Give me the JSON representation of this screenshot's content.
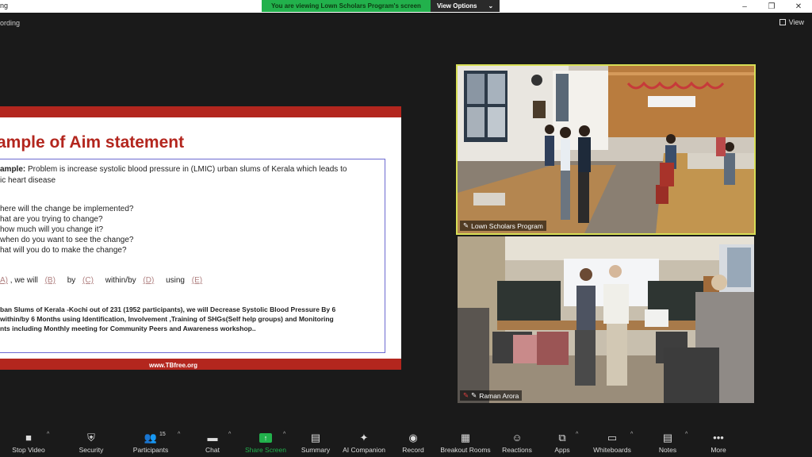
{
  "window": {
    "title": "ng",
    "minimize_glyph": "–",
    "maximize_glyph": "❐",
    "close_glyph": "✕"
  },
  "share_banner": {
    "message": "You are viewing Lown Scholars Program's screen",
    "options_label": "View Options",
    "options_caret": "⌄"
  },
  "recording_label": "ording",
  "view_label": "View",
  "slide": {
    "title": "ample of Aim statement",
    "example_label": "ample:",
    "example_text": " Problem is increase systolic blood pressure in (LMIC) urban slums of Kerala which leads to",
    "example_text2": "ic heart disease",
    "questions": [
      "here will the change be implemented?",
      "hat are you trying to change?",
      "how much will you change it?",
      "when do you want to see the change?",
      "hat will you do to make the change?"
    ],
    "template": {
      "a": "A)",
      "we_will": ", we will",
      "b": "(B)",
      "by": "by",
      "c": "(C)",
      "within": "within/by",
      "d": "(D)",
      "using": "using",
      "e": "(E)"
    },
    "answer_lines": [
      "ban Slums of Kerala -Kochi out of 231 (1952 participants), we will Decrease Systolic Blood Pressure By 6",
      "within/by 6 Months using Identification, Involvement ,Training of SHGs(Self help groups) and Monitoring",
      "nts including Monthly meeting for Community Peers and Awareness workshop.."
    ],
    "footer_url": "www.TBfree.org"
  },
  "participants": [
    {
      "name": "Lown Scholars Program",
      "active_speaker": true
    },
    {
      "name": "Raman Arora",
      "active_speaker": false
    }
  ],
  "toolbar": {
    "items": [
      {
        "label": "Stop Video",
        "icon": "■"
      },
      {
        "label": "Security",
        "icon": "⛨"
      },
      {
        "label": "Participants",
        "icon": "👥",
        "count": "15"
      },
      {
        "label": "Chat",
        "icon": "▬"
      },
      {
        "label": "Share Screen",
        "icon": "↑"
      },
      {
        "label": "Summary",
        "icon": "▤"
      },
      {
        "label": "AI Companion",
        "icon": "✦"
      },
      {
        "label": "Record",
        "icon": "◉"
      },
      {
        "label": "Breakout Rooms",
        "icon": "▦"
      },
      {
        "label": "Reactions",
        "icon": "☺"
      },
      {
        "label": "Apps",
        "icon": "⧉"
      },
      {
        "label": "Whiteboards",
        "icon": "▭"
      },
      {
        "label": "Notes",
        "icon": "▤"
      },
      {
        "label": "More",
        "icon": "•••"
      }
    ],
    "caret": "^"
  },
  "colors": {
    "banner_green": "#22b14c",
    "slide_red": "#b3261e",
    "speaker_border": "#d7de55",
    "background": "#1a1a1a"
  }
}
